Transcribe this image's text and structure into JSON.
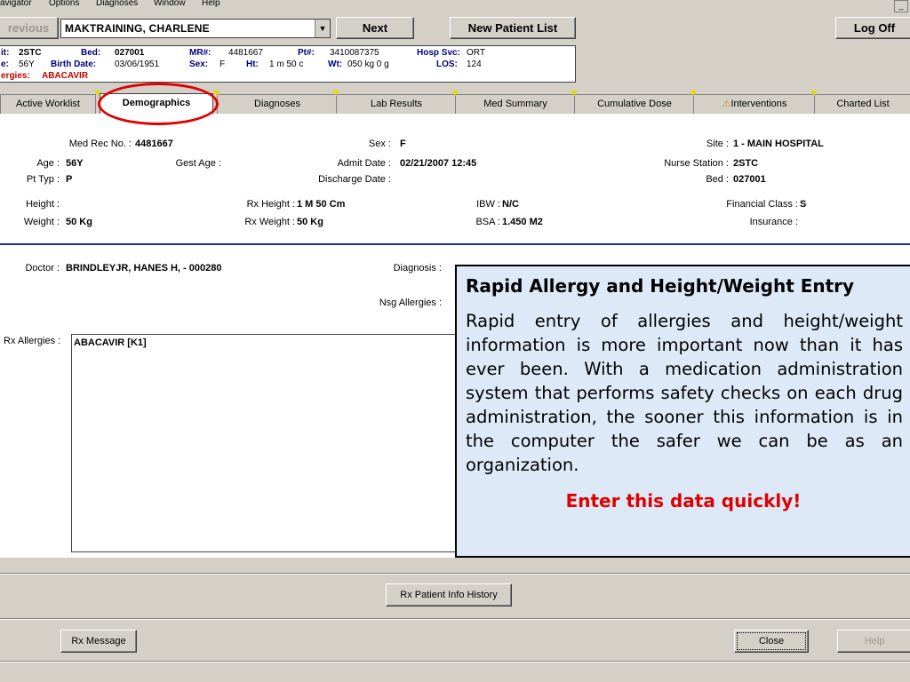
{
  "menu": [
    "avigator",
    "Options",
    "Diagnoses",
    "Window",
    "Help"
  ],
  "toolbar": {
    "previous_label": "revious",
    "patient_name": "MAKTRAINING, CHARLENE",
    "next_label": "Next",
    "new_list_label": "New Patient List",
    "logoff_label": "Log Off"
  },
  "banner": {
    "unit_label": "it:",
    "unit": "2STC",
    "bed_label": "Bed:",
    "bed": "027001",
    "mr_label": "MR#:",
    "mr": "4481667",
    "pt_label": "Pt#:",
    "pt": "3410087375",
    "svc_label": "Hosp Svc:",
    "svc": "ORT",
    "age_label": "e:",
    "age": "56Y",
    "bd_label": "Birth Date:",
    "bd": "03/06/1951",
    "sex_label": "Sex:",
    "sex": "F",
    "ht_label": "Ht:",
    "ht": "1 m 50 c",
    "wt_label": "Wt:",
    "wt": "050 kg 0 g",
    "los_label": "LOS:",
    "los": "124",
    "allergy_label": "ergies:",
    "allergy": "ABACAVIR"
  },
  "tabs": [
    "Active Worklist",
    "Demographics",
    "Diagnoses",
    "Lab Results",
    "Med Summary",
    "Cumulative Dose",
    "Interventions",
    "Charted List"
  ],
  "demo": {
    "medrec_label": "Med Rec No. :",
    "medrec": "4481667",
    "sex_label": "Sex :",
    "sex": "F",
    "site_label": "Site :",
    "site": "1 - MAIN HOSPITAL",
    "age_label": "Age :",
    "age": "56Y",
    "gestage_label": "Gest Age :",
    "admit_label": "Admit Date :",
    "admit": "02/21/2007 12:45",
    "nurse_label": "Nurse Station :",
    "nurse": "2STC",
    "pttyp_label": "Pt Typ :",
    "pttyp": "P",
    "discharge_label": "Discharge Date :",
    "bed_label": "Bed :",
    "bed": "027001",
    "height_label": "Height :",
    "rxheight_label": "Rx Height :",
    "rxheight": "1 M 50 Cm",
    "ibw_label": "IBW :",
    "ibw": "N/C",
    "fin_label": "Financial Class :",
    "fin": "S",
    "weight_label": "Weight :",
    "weight": "50 Kg",
    "rxweight_label": "Rx Weight :",
    "rxweight": "50 Kg",
    "bsa_label": "BSA :",
    "bsa": "1.450 M2",
    "ins_label": "Insurance :"
  },
  "clinical": {
    "doctor_label": "Doctor :",
    "doctor": "BRINDLEYJR, HANES H,  - 000280",
    "diag_label": "Diagnosis :",
    "nsg_label": "Nsg Allergies :",
    "rx_label": "Rx Allergies :",
    "rx_value": "ABACAVIR [K1]"
  },
  "callout": {
    "title": "Rapid Allergy and Height/Weight Entry",
    "body": "Rapid entry of allergies and height/weight information is more important now than it has ever been. With a medication administration system that performs safety checks on each drug administration, the sooner this information is in the computer the safer we can be as an organization.",
    "emphasis": "Enter this data quickly!"
  },
  "footer": {
    "history_label": "Rx Patient Info History",
    "message_label": "Rx Message",
    "close_label": "Close",
    "help_label": "Help"
  },
  "colors": {
    "highlight_ellipse": "#e00000",
    "callout_bg": "#dde9f7",
    "banner_label": "#000080"
  }
}
